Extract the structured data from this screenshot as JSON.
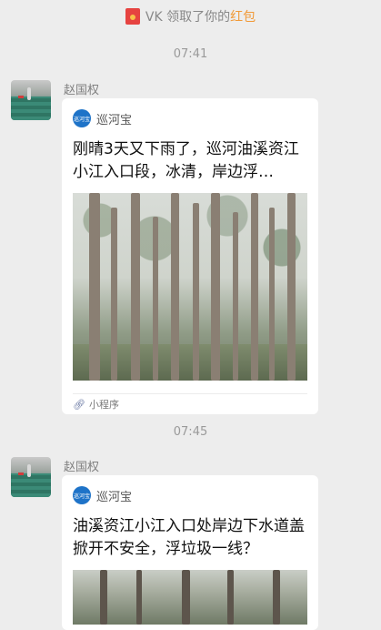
{
  "system_notice": {
    "prefix": "VK 领取了你的",
    "link": "红包"
  },
  "messages": [
    {
      "time": "07:41",
      "sender": "赵国权",
      "miniprogram": {
        "app_name": "巡河宝",
        "logo_text": "巡河宝",
        "title": "刚晴3天又下雨了，巡河油溪资江小江入口段，冰清，岸边浮…",
        "footer": "小程序"
      }
    },
    {
      "time": "07:45",
      "sender": "赵国权",
      "miniprogram": {
        "app_name": "巡河宝",
        "logo_text": "巡河宝",
        "title": "油溪资江小江入口处岸边下水道盖掀开不安全，浮垃圾一线？"
      }
    }
  ],
  "colors": {
    "background": "#ededed",
    "notice_link": "#f19a38",
    "redpacket": "#e64340",
    "mp_logo": "#1e73c8"
  }
}
